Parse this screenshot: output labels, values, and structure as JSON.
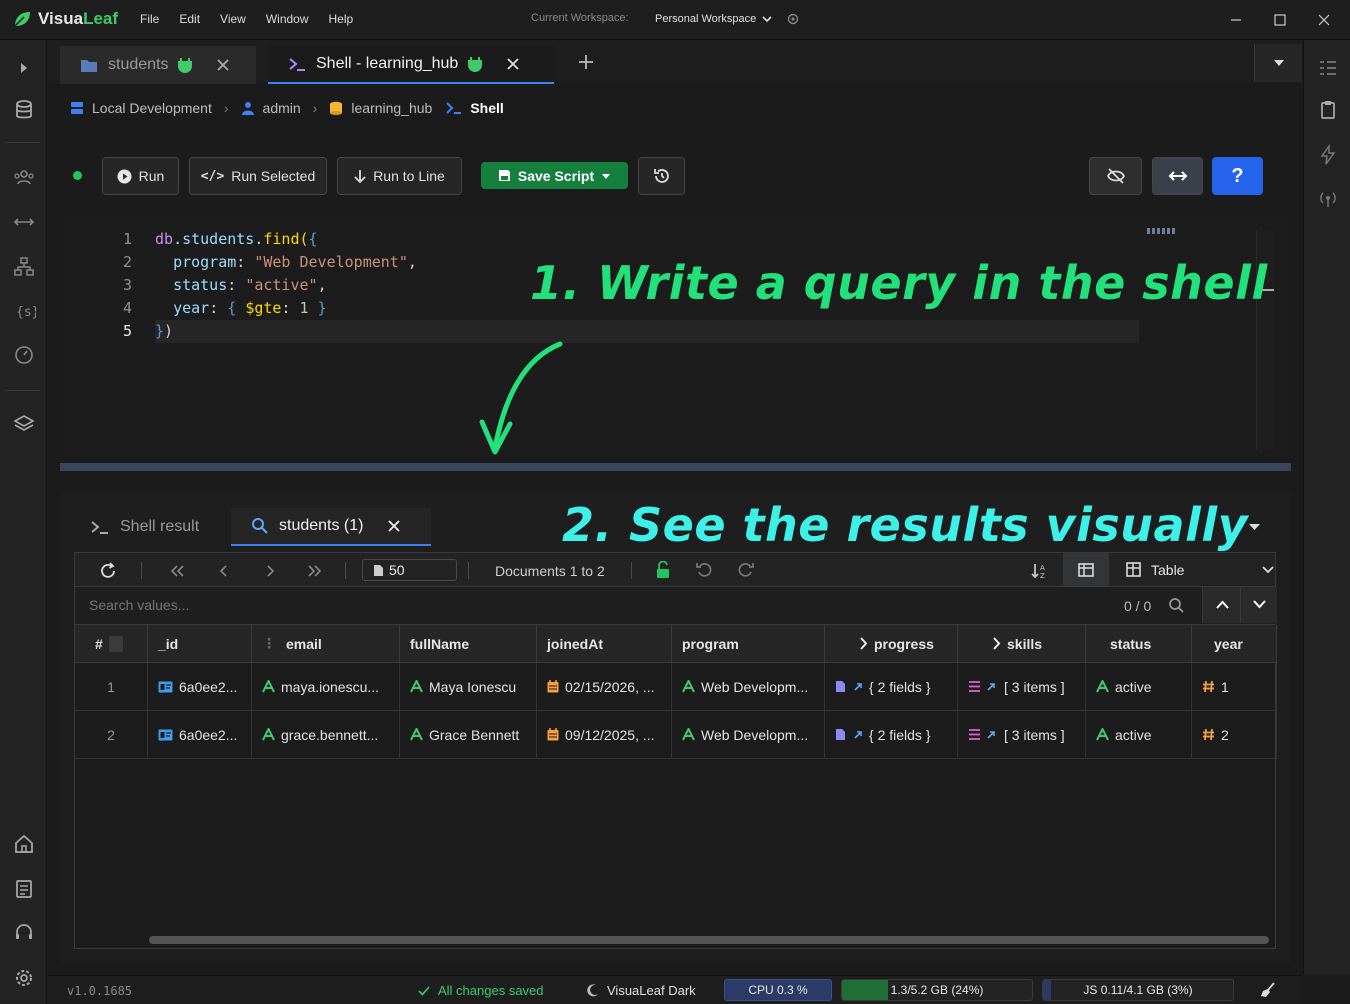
{
  "app": {
    "name_prefix": "Visua",
    "name_suffix": "Leaf",
    "menu": [
      "File",
      "Edit",
      "View",
      "Window",
      "Help"
    ],
    "workspace_label": "Current Workspace:",
    "workspace_value": "Personal Workspace"
  },
  "tabs": [
    {
      "label": "students",
      "icon": "folder-icon",
      "active": false
    },
    {
      "label": "Shell - learning_hub",
      "icon": "terminal-icon",
      "active": true
    }
  ],
  "breadcrumb": [
    {
      "label": "Local Development",
      "icon": "database-icon"
    },
    {
      "label": "admin",
      "icon": "user-icon"
    },
    {
      "label": "learning_hub",
      "icon": "db-stack-icon"
    },
    {
      "label": "Shell",
      "icon": "terminal-icon"
    }
  ],
  "toolbar": {
    "run": "Run",
    "run_selected": "Run Selected",
    "run_to_line": "Run to Line",
    "save_script": "Save Script",
    "help": "?"
  },
  "editor": {
    "line_numbers": [
      "1",
      "2",
      "3",
      "4",
      "5"
    ],
    "lines": [
      "db.students.find({",
      "  program: \"Web Development\",",
      "  status: \"active\",",
      "  year: { $gte: 1 }",
      "})"
    ]
  },
  "annotations": {
    "step1": "1. Write a query in the shell",
    "step2": "2. See the results visually",
    "step1_color": "#22e07a",
    "step2_color": "#3df0e8"
  },
  "results": {
    "tabs": [
      {
        "label": "Shell result",
        "active": false
      },
      {
        "label": "students (1)",
        "active": true
      }
    ],
    "page_size": "50",
    "documents_label": "Documents 1 to 2",
    "view_mode": "Table",
    "search_placeholder": "Search values...",
    "search_count": "0 / 0",
    "columns": [
      "#",
      "_id",
      "email",
      "fullName",
      "joinedAt",
      "program",
      "progress",
      "skills",
      "status",
      "year"
    ],
    "rows": [
      {
        "num": "1",
        "_id": "6a0ee2...",
        "email": "maya.ionescu...",
        "fullName": "Maya Ionescu",
        "joinedAt": "02/15/2026, ...",
        "program": "Web Developm...",
        "progress": "{ 2 fields }",
        "skills": "[ 3 items ]",
        "status": "active",
        "year": "1"
      },
      {
        "num": "2",
        "_id": "6a0ee2...",
        "email": "grace.bennett...",
        "fullName": "Grace Bennett",
        "joinedAt": "09/12/2025, ...",
        "program": "Web Developm...",
        "progress": "{ 2 fields }",
        "skills": "[ 3 items ]",
        "status": "active",
        "year": "2"
      }
    ]
  },
  "statusbar": {
    "version": "v1.0.1685",
    "saved": "All changes saved",
    "theme": "VisuaLeaf Dark",
    "cpu": "CPU 0.3 %",
    "memory": "1.3/5.2 GB (24%)",
    "memory_fraction": 0.24,
    "js_heap": "JS 0.11/4.1 GB (3%)",
    "js_fraction": 0.03
  },
  "colors": {
    "accent_blue": "#2563eb",
    "save_green": "#15803d",
    "brand_green": "#3ecb6a"
  }
}
